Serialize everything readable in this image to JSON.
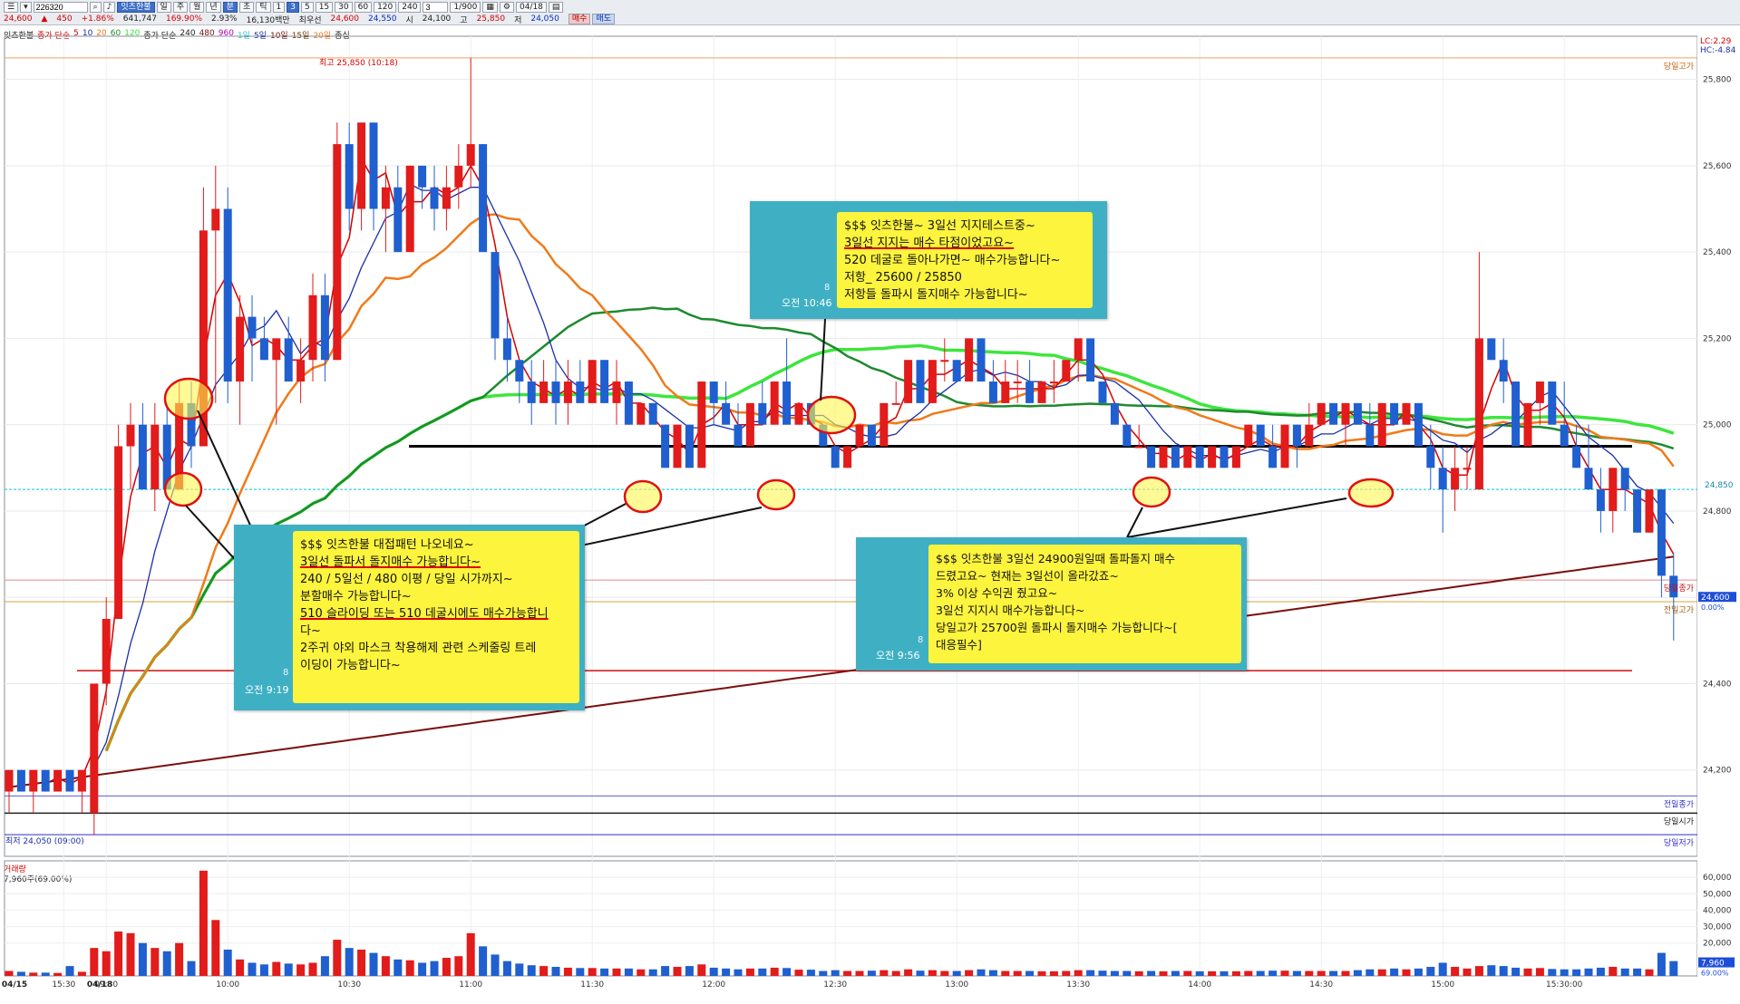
{
  "toolbar": {
    "code": "226320",
    "name": "잇츠한불",
    "periods": [
      "일",
      "주",
      "월",
      "년",
      "분",
      "초",
      "틱"
    ],
    "minutes": [
      "1",
      "3",
      "5",
      "15",
      "30",
      "60",
      "120",
      "240"
    ],
    "count": "3",
    "view": "1/900",
    "date": "04/18",
    "price": "24,600",
    "change": "450",
    "rate": "+1.86%",
    "volume": "641,747",
    "vol_rate": "169.90%",
    "turnover": "2.93%",
    "amount": "16,130백만",
    "best_ask": "24,600",
    "best_bid": "24,550",
    "open_label": "시",
    "open": "24,100",
    "high_label": "고",
    "high": "25,850",
    "low_label": "저",
    "low": "24,050",
    "buy": "매수",
    "sell": "매도",
    "priority_label": "최우선"
  },
  "legend": {
    "name": "잇츠한불",
    "ma1_label": "종가 단순",
    "ma1_periods": [
      "5",
      "10",
      "20",
      "60",
      "120"
    ],
    "ma2_label": "종가 단순",
    "ma2_periods": [
      "240",
      "480",
      "960"
    ],
    "day_marks": [
      "1일",
      "5일",
      "10일",
      "15일",
      "20일"
    ],
    "extra": "종십"
  },
  "volume_legend": {
    "title": "거래량",
    "value": "7,960주(69.00%)"
  },
  "right_axis": {
    "lc": "LC:2.29",
    "hc": "HC:-4.84",
    "current": "24,600",
    "current_pct": "0.00%",
    "prev_close_label": "24,850",
    "vol_current": "7,960",
    "vol_pct": "69.00%"
  },
  "ref_labels": {
    "day_high": "당일고가",
    "prev_close": "당일종가",
    "prev_high": "전일고가",
    "prev_close2": "전일종가",
    "day_open": "당일시가",
    "day_low": "당일저가"
  },
  "annotations": {
    "high": "최고 25,850 (10:18)",
    "low": "최저 24,050 (09:00)"
  },
  "callouts": [
    {
      "time": "오전 9:19",
      "count": "8",
      "lines": [
        "$$$ 잇츠한불 대접패턴 나오네요~",
        "3일선 돌파서 돌지매수 가능합니다~",
        "240 / 5일선 / 480 이평 / 당일 시가까지~",
        "분할매수 가능합니다~",
        "510 슬라이딩 또는 510 데굴시에도 매수가능합니",
        "다~",
        "2주귀 야외 마스크 착용해제 관련 스케줄링 트레",
        "이딩이 가능합니다~"
      ]
    },
    {
      "time": "오전 10:46",
      "count": "8",
      "lines": [
        "$$$ 잇츠한불~ 3일선 지지테스트중~",
        "3일선 지지는 매수 타점이었고요~",
        "520 데굴로 돌아나가면~ 매수가능합니다~",
        "저항_ 25600 / 25850",
        "저항들 돌파시 돌지매수 가능합니다~"
      ]
    },
    {
      "time": "오전 9:56",
      "count": "8",
      "lines": [
        "$$$ 잇츠한불 3일선 24900원일때 돌파돌지 매수",
        "드렸고요~ 현재는 3일선이 올라갔죠~",
        "3% 이상 수익권 줬고요~",
        "3일선 지지시 매수가능합니다~",
        "당일고가 25700원 돌파시 돌지매수 가능합니다~[",
        "대응필수]"
      ]
    }
  ],
  "chart_data": {
    "type": "candlestick",
    "interval": "3분",
    "date_labels": [
      "04/15",
      "04/18"
    ],
    "x_labels": [
      "15:30",
      "09:30",
      "10:00",
      "10:30",
      "11:00",
      "11:30",
      "12:00",
      "12:30",
      "13:00",
      "13:30",
      "14:00",
      "14:30",
      "15:00",
      "15:30:00"
    ],
    "y_ticks": [
      24200,
      24400,
      24600,
      24800,
      25000,
      25200,
      25400,
      25600,
      25800
    ],
    "ylim": [
      24000,
      25900
    ],
    "volume_ticks": [
      20000,
      30000,
      40000,
      50000,
      60000
    ],
    "volume_ylim": [
      0,
      70000
    ],
    "reference_lines": {
      "day_high": 25850,
      "prev_close": 24850,
      "three_day_line": 24950,
      "day_close": 24640,
      "prev_high": 24590,
      "red_line": 24430,
      "prev_close2": 24140,
      "day_open": 24100,
      "day_low": 24050
    },
    "candles": [
      {
        "o": 24150,
        "h": 24200,
        "l": 24100,
        "c": 24200,
        "v": 3000
      },
      {
        "o": 24200,
        "h": 24200,
        "l": 24150,
        "c": 24150,
        "v": 2500
      },
      {
        "o": 24150,
        "h": 24200,
        "l": 24100,
        "c": 24200,
        "v": 2000
      },
      {
        "o": 24200,
        "h": 24200,
        "l": 24150,
        "c": 24150,
        "v": 2000
      },
      {
        "o": 24150,
        "h": 24200,
        "l": 24150,
        "c": 24200,
        "v": 1800
      },
      {
        "o": 24200,
        "h": 24200,
        "l": 24150,
        "c": 24150,
        "v": 6000
      },
      {
        "o": 24150,
        "h": 24200,
        "l": 24100,
        "c": 24200,
        "v": 2500
      },
      {
        "o": 24100,
        "h": 24400,
        "l": 24050,
        "c": 24400,
        "v": 17000
      },
      {
        "o": 24400,
        "h": 24600,
        "l": 24350,
        "c": 24550,
        "v": 15000
      },
      {
        "o": 24550,
        "h": 25000,
        "l": 24550,
        "c": 24950,
        "v": 27000
      },
      {
        "o": 24950,
        "h": 25050,
        "l": 24850,
        "c": 25000,
        "v": 26000
      },
      {
        "o": 25000,
        "h": 25050,
        "l": 24850,
        "c": 24850,
        "v": 20000
      },
      {
        "o": 24850,
        "h": 25050,
        "l": 24800,
        "c": 25000,
        "v": 17000
      },
      {
        "o": 25000,
        "h": 25050,
        "l": 24850,
        "c": 24850,
        "v": 15000
      },
      {
        "o": 24850,
        "h": 25100,
        "l": 24850,
        "c": 25050,
        "v": 20000
      },
      {
        "o": 25050,
        "h": 25100,
        "l": 24900,
        "c": 24950,
        "v": 9000
      },
      {
        "o": 24950,
        "h": 25550,
        "l": 24950,
        "c": 25450,
        "v": 64000
      },
      {
        "o": 25450,
        "h": 25600,
        "l": 25050,
        "c": 25500,
        "v": 34000
      },
      {
        "o": 25500,
        "h": 25550,
        "l": 25050,
        "c": 25100,
        "v": 16000
      },
      {
        "o": 25100,
        "h": 25300,
        "l": 25000,
        "c": 25250,
        "v": 10000
      },
      {
        "o": 25250,
        "h": 25300,
        "l": 25100,
        "c": 25200,
        "v": 8000
      },
      {
        "o": 25200,
        "h": 25250,
        "l": 25150,
        "c": 25150,
        "v": 7000
      },
      {
        "o": 25150,
        "h": 25200,
        "l": 25000,
        "c": 25200,
        "v": 8500
      },
      {
        "o": 25200,
        "h": 25250,
        "l": 25100,
        "c": 25100,
        "v": 7500
      },
      {
        "o": 25100,
        "h": 25200,
        "l": 25050,
        "c": 25150,
        "v": 7000
      },
      {
        "o": 25150,
        "h": 25350,
        "l": 25100,
        "c": 25300,
        "v": 8000
      },
      {
        "o": 25300,
        "h": 25350,
        "l": 25100,
        "c": 25150,
        "v": 12000
      },
      {
        "o": 25150,
        "h": 25700,
        "l": 25150,
        "c": 25650,
        "v": 22000
      },
      {
        "o": 25650,
        "h": 25700,
        "l": 25450,
        "c": 25500,
        "v": 17000
      },
      {
        "o": 25500,
        "h": 25700,
        "l": 25450,
        "c": 25700,
        "v": 16000
      },
      {
        "o": 25700,
        "h": 25700,
        "l": 25450,
        "c": 25500,
        "v": 14000
      },
      {
        "o": 25500,
        "h": 25600,
        "l": 25400,
        "c": 25550,
        "v": 12000
      },
      {
        "o": 25550,
        "h": 25600,
        "l": 25400,
        "c": 25400,
        "v": 10000
      },
      {
        "o": 25400,
        "h": 25600,
        "l": 25400,
        "c": 25600,
        "v": 9500
      },
      {
        "o": 25600,
        "h": 25600,
        "l": 25500,
        "c": 25550,
        "v": 8000
      },
      {
        "o": 25550,
        "h": 25600,
        "l": 25450,
        "c": 25500,
        "v": 9000
      },
      {
        "o": 25500,
        "h": 25600,
        "l": 25450,
        "c": 25550,
        "v": 11000
      },
      {
        "o": 25550,
        "h": 25650,
        "l": 25500,
        "c": 25600,
        "v": 12000
      },
      {
        "o": 25600,
        "h": 25850,
        "l": 25550,
        "c": 25650,
        "v": 26000
      },
      {
        "o": 25650,
        "h": 25650,
        "l": 25400,
        "c": 25400,
        "v": 18000
      },
      {
        "o": 25400,
        "h": 25400,
        "l": 25150,
        "c": 25200,
        "v": 13000
      },
      {
        "o": 25200,
        "h": 25250,
        "l": 25100,
        "c": 25150,
        "v": 9000
      },
      {
        "o": 25150,
        "h": 25150,
        "l": 25050,
        "c": 25100,
        "v": 7500
      },
      {
        "o": 25100,
        "h": 25150,
        "l": 25000,
        "c": 25050,
        "v": 6500
      },
      {
        "o": 25050,
        "h": 25150,
        "l": 25050,
        "c": 25100,
        "v": 6000
      },
      {
        "o": 25100,
        "h": 25150,
        "l": 25000,
        "c": 25050,
        "v": 5500
      },
      {
        "o": 25050,
        "h": 25150,
        "l": 25000,
        "c": 25100,
        "v": 5000
      },
      {
        "o": 25100,
        "h": 25150,
        "l": 25050,
        "c": 25050,
        "v": 4800
      },
      {
        "o": 25050,
        "h": 25150,
        "l": 25050,
        "c": 25150,
        "v": 4800
      },
      {
        "o": 25150,
        "h": 25150,
        "l": 25050,
        "c": 25050,
        "v": 4500
      },
      {
        "o": 25050,
        "h": 25150,
        "l": 25000,
        "c": 25100,
        "v": 4500
      },
      {
        "o": 25100,
        "h": 25100,
        "l": 25000,
        "c": 25000,
        "v": 4500
      },
      {
        "o": 25000,
        "h": 25050,
        "l": 25000,
        "c": 25050,
        "v": 4000
      },
      {
        "o": 25050,
        "h": 25050,
        "l": 25000,
        "c": 25000,
        "v": 4000
      },
      {
        "o": 25000,
        "h": 25000,
        "l": 24900,
        "c": 24900,
        "v": 6000
      },
      {
        "o": 24900,
        "h": 25000,
        "l": 24900,
        "c": 25000,
        "v": 5500
      },
      {
        "o": 25000,
        "h": 25000,
        "l": 24900,
        "c": 24900,
        "v": 6000
      },
      {
        "o": 24900,
        "h": 25100,
        "l": 24900,
        "c": 25100,
        "v": 7000
      },
      {
        "o": 25100,
        "h": 25100,
        "l": 25000,
        "c": 25050,
        "v": 5000
      },
      {
        "o": 25050,
        "h": 25100,
        "l": 25000,
        "c": 25000,
        "v": 4500
      },
      {
        "o": 25000,
        "h": 25050,
        "l": 24950,
        "c": 24950,
        "v": 4000
      },
      {
        "o": 24950,
        "h": 25050,
        "l": 24950,
        "c": 25050,
        "v": 4500
      },
      {
        "o": 25050,
        "h": 25100,
        "l": 25000,
        "c": 25000,
        "v": 4500
      },
      {
        "o": 25000,
        "h": 25100,
        "l": 25000,
        "c": 25100,
        "v": 5000
      },
      {
        "o": 25100,
        "h": 25200,
        "l": 25000,
        "c": 25000,
        "v": 4800
      },
      {
        "o": 25000,
        "h": 25050,
        "l": 25000,
        "c": 25050,
        "v": 3800
      },
      {
        "o": 25050,
        "h": 25050,
        "l": 25000,
        "c": 25000,
        "v": 3800
      },
      {
        "o": 25000,
        "h": 25000,
        "l": 24950,
        "c": 24950,
        "v": 3000
      },
      {
        "o": 24950,
        "h": 24950,
        "l": 24900,
        "c": 24900,
        "v": 3500
      },
      {
        "o": 24900,
        "h": 24950,
        "l": 24900,
        "c": 24950,
        "v": 3000
      },
      {
        "o": 24950,
        "h": 25000,
        "l": 24950,
        "c": 25000,
        "v": 3000
      },
      {
        "o": 25000,
        "h": 25000,
        "l": 24950,
        "c": 24950,
        "v": 3200
      },
      {
        "o": 24950,
        "h": 25050,
        "l": 24950,
        "c": 25050,
        "v": 3500
      },
      {
        "o": 25050,
        "h": 25100,
        "l": 25050,
        "c": 25050,
        "v": 3000
      },
      {
        "o": 25050,
        "h": 25150,
        "l": 25050,
        "c": 25150,
        "v": 4000
      },
      {
        "o": 25150,
        "h": 25150,
        "l": 25050,
        "c": 25050,
        "v": 3200
      },
      {
        "o": 25050,
        "h": 25150,
        "l": 25050,
        "c": 25150,
        "v": 3500
      },
      {
        "o": 25150,
        "h": 25200,
        "l": 25100,
        "c": 25150,
        "v": 3000
      },
      {
        "o": 25150,
        "h": 25150,
        "l": 25100,
        "c": 25100,
        "v": 3000
      },
      {
        "o": 25100,
        "h": 25200,
        "l": 25100,
        "c": 25200,
        "v": 3500
      },
      {
        "o": 25200,
        "h": 25200,
        "l": 25100,
        "c": 25100,
        "v": 4000
      },
      {
        "o": 25100,
        "h": 25150,
        "l": 25050,
        "c": 25050,
        "v": 3500
      },
      {
        "o": 25050,
        "h": 25150,
        "l": 25050,
        "c": 25100,
        "v": 3000
      },
      {
        "o": 25100,
        "h": 25150,
        "l": 25050,
        "c": 25100,
        "v": 3000
      },
      {
        "o": 25100,
        "h": 25150,
        "l": 25050,
        "c": 25050,
        "v": 3000
      },
      {
        "o": 25050,
        "h": 25100,
        "l": 25050,
        "c": 25100,
        "v": 2800
      },
      {
        "o": 25100,
        "h": 25150,
        "l": 25050,
        "c": 25100,
        "v": 2800
      },
      {
        "o": 25100,
        "h": 25150,
        "l": 25100,
        "c": 25150,
        "v": 3000
      },
      {
        "o": 25150,
        "h": 25200,
        "l": 25100,
        "c": 25200,
        "v": 3500
      },
      {
        "o": 25200,
        "h": 25200,
        "l": 25100,
        "c": 25100,
        "v": 3500
      },
      {
        "o": 25100,
        "h": 25100,
        "l": 25050,
        "c": 25050,
        "v": 3200
      },
      {
        "o": 25050,
        "h": 25050,
        "l": 25000,
        "c": 25000,
        "v": 3000
      },
      {
        "o": 25000,
        "h": 25000,
        "l": 24950,
        "c": 24950,
        "v": 3000
      },
      {
        "o": 24950,
        "h": 25000,
        "l": 24950,
        "c": 24950,
        "v": 2800
      },
      {
        "o": 24950,
        "h": 24950,
        "l": 24900,
        "c": 24900,
        "v": 3000
      },
      {
        "o": 24900,
        "h": 24950,
        "l": 24900,
        "c": 24950,
        "v": 2800
      },
      {
        "o": 24950,
        "h": 24950,
        "l": 24900,
        "c": 24900,
        "v": 3000
      },
      {
        "o": 24900,
        "h": 24950,
        "l": 24900,
        "c": 24950,
        "v": 3000
      },
      {
        "o": 24950,
        "h": 24950,
        "l": 24900,
        "c": 24900,
        "v": 2800
      },
      {
        "o": 24900,
        "h": 24950,
        "l": 24900,
        "c": 24950,
        "v": 2800
      },
      {
        "o": 24950,
        "h": 24950,
        "l": 24900,
        "c": 24900,
        "v": 2800
      },
      {
        "o": 24900,
        "h": 24950,
        "l": 24900,
        "c": 24950,
        "v": 2800
      },
      {
        "o": 24950,
        "h": 25000,
        "l": 24950,
        "c": 25000,
        "v": 3000
      },
      {
        "o": 25000,
        "h": 25000,
        "l": 24950,
        "c": 24950,
        "v": 3000
      },
      {
        "o": 24950,
        "h": 25000,
        "l": 24900,
        "c": 24900,
        "v": 3200
      },
      {
        "o": 24900,
        "h": 25000,
        "l": 24900,
        "c": 25000,
        "v": 3200
      },
      {
        "o": 25000,
        "h": 25000,
        "l": 24900,
        "c": 24950,
        "v": 3000
      },
      {
        "o": 24950,
        "h": 25050,
        "l": 24950,
        "c": 25000,
        "v": 3000
      },
      {
        "o": 25000,
        "h": 25050,
        "l": 25000,
        "c": 25050,
        "v": 3000
      },
      {
        "o": 25050,
        "h": 25050,
        "l": 25000,
        "c": 25000,
        "v": 3000
      },
      {
        "o": 25000,
        "h": 25050,
        "l": 24950,
        "c": 25050,
        "v": 3000
      },
      {
        "o": 25050,
        "h": 25050,
        "l": 25000,
        "c": 25000,
        "v": 3500
      },
      {
        "o": 25000,
        "h": 25050,
        "l": 24950,
        "c": 24950,
        "v": 4000
      },
      {
        "o": 24950,
        "h": 25050,
        "l": 24950,
        "c": 25050,
        "v": 4000
      },
      {
        "o": 25050,
        "h": 25050,
        "l": 25000,
        "c": 25000,
        "v": 4500
      },
      {
        "o": 25000,
        "h": 25050,
        "l": 25000,
        "c": 25050,
        "v": 4000
      },
      {
        "o": 25050,
        "h": 25050,
        "l": 24950,
        "c": 24950,
        "v": 4500
      },
      {
        "o": 24950,
        "h": 25000,
        "l": 24850,
        "c": 24900,
        "v": 5500
      },
      {
        "o": 24900,
        "h": 24950,
        "l": 24750,
        "c": 24850,
        "v": 8000
      },
      {
        "o": 24850,
        "h": 24950,
        "l": 24800,
        "c": 24900,
        "v": 5500
      },
      {
        "o": 24900,
        "h": 24950,
        "l": 24850,
        "c": 24900,
        "v": 4500
      },
      {
        "o": 24850,
        "h": 25400,
        "l": 24850,
        "c": 25200,
        "v": 6000
      },
      {
        "o": 25200,
        "h": 25200,
        "l": 25150,
        "c": 25150,
        "v": 6500
      },
      {
        "o": 25150,
        "h": 25200,
        "l": 25050,
        "c": 25100,
        "v": 6000
      },
      {
        "o": 25100,
        "h": 25100,
        "l": 24950,
        "c": 24950,
        "v": 5000
      },
      {
        "o": 24950,
        "h": 25050,
        "l": 24950,
        "c": 25050,
        "v": 4500
      },
      {
        "o": 25050,
        "h": 25100,
        "l": 25000,
        "c": 25100,
        "v": 4800
      },
      {
        "o": 25100,
        "h": 25100,
        "l": 25000,
        "c": 25000,
        "v": 4200
      },
      {
        "o": 25000,
        "h": 25100,
        "l": 24950,
        "c": 24950,
        "v": 4000
      },
      {
        "o": 24950,
        "h": 25000,
        "l": 24900,
        "c": 24900,
        "v": 4000
      },
      {
        "o": 24900,
        "h": 25000,
        "l": 24850,
        "c": 24850,
        "v": 4500
      },
      {
        "o": 24850,
        "h": 24900,
        "l": 24750,
        "c": 24800,
        "v": 5000
      },
      {
        "o": 24800,
        "h": 24900,
        "l": 24750,
        "c": 24900,
        "v": 5500
      },
      {
        "o": 24900,
        "h": 24900,
        "l": 24800,
        "c": 24850,
        "v": 4500
      },
      {
        "o": 24850,
        "h": 24850,
        "l": 24750,
        "c": 24750,
        "v": 4500
      },
      {
        "o": 24750,
        "h": 24850,
        "l": 24750,
        "c": 24850,
        "v": 4000
      },
      {
        "o": 24850,
        "h": 24850,
        "l": 24600,
        "c": 24650,
        "v": 14000
      },
      {
        "o": 24650,
        "h": 24700,
        "l": 24500,
        "c": 24600,
        "v": 9000
      }
    ]
  }
}
